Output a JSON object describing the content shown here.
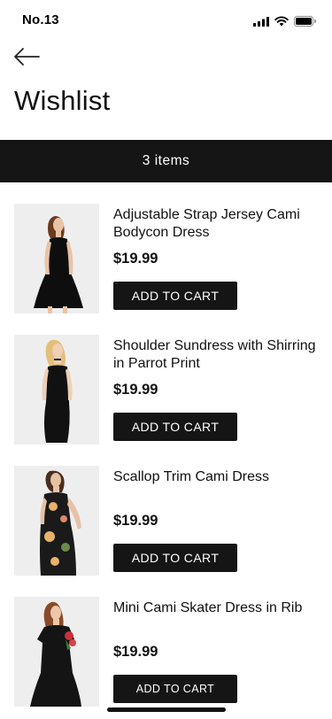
{
  "status_bar": {
    "time": "No.13",
    "icons": [
      "signal-icon",
      "wifi-icon",
      "battery-icon"
    ]
  },
  "header": {
    "back_icon": "back-arrow-icon",
    "title": "Wishlist"
  },
  "summary": {
    "count_text": "3 items"
  },
  "items": [
    {
      "name": "Adjustable Strap Jersey Cami Bodycon Dress",
      "price": "$19.99",
      "button_label": "ADD TO CART"
    },
    {
      "name": "Shoulder Sundress with Shirring in Parrot Print",
      "price": "$19.99",
      "button_label": "ADD TO CART"
    },
    {
      "name": "Scallop Trim Cami Dress",
      "price": "$19.99",
      "button_label": "ADD TO CART"
    },
    {
      "name": "Mini Cami Skater Dress in Rib",
      "price": "$19.99",
      "button_label": "ADD TO CART"
    }
  ],
  "colors": {
    "bar_background": "#151515",
    "button_background": "#151515",
    "text": "#111111"
  }
}
